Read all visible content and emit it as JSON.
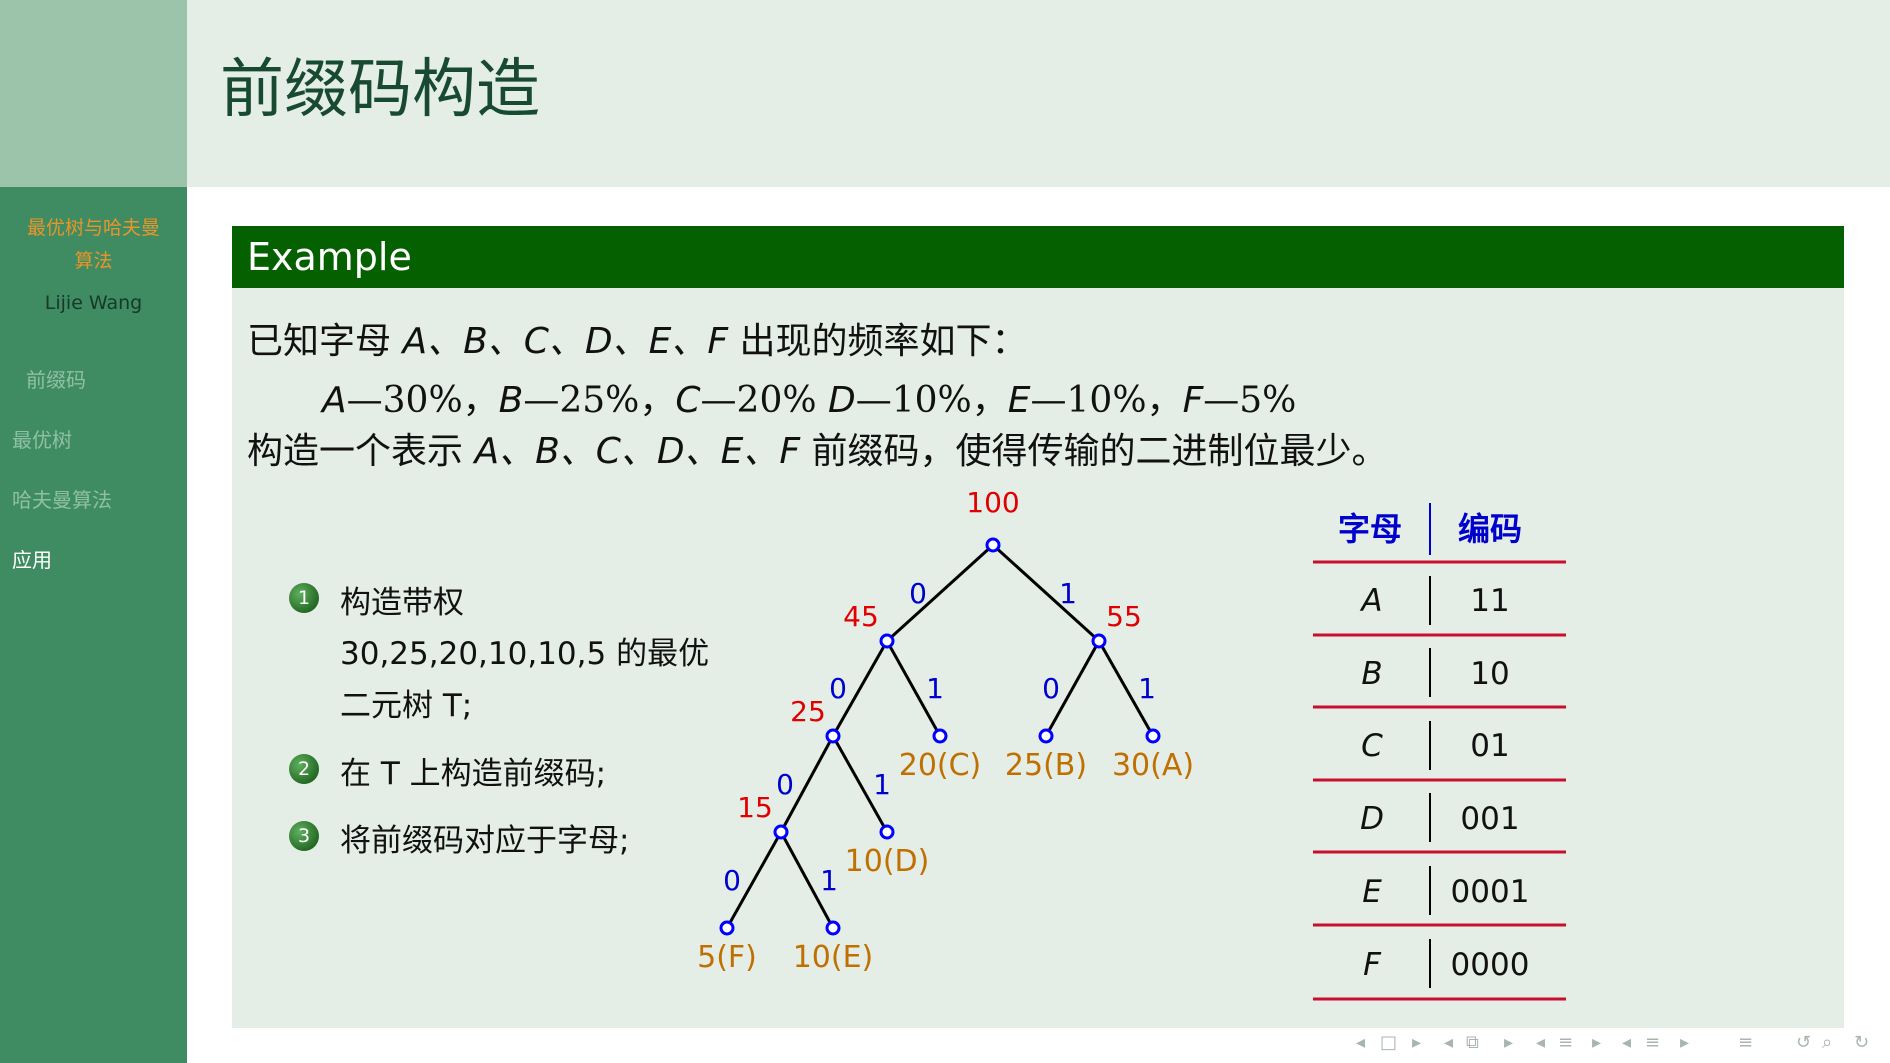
{
  "sidebar": {
    "title_lines": [
      "最优树与哈夫曼",
      "算法"
    ],
    "author": "Lijie Wang",
    "nav": [
      "前缀码",
      "最优树",
      "哈夫曼算法",
      "应用"
    ],
    "active": "应用"
  },
  "frame_title": "前缀码构造",
  "block": {
    "title": "Example",
    "line1": {
      "pre": "已知字母 ",
      "letters": "A、B、C、D、E、F",
      "post": " 出现的频率如下："
    },
    "freq": [
      {
        "letter": "A",
        "value": "—30%",
        "sep": "，"
      },
      {
        "letter": "B",
        "value": "—25%",
        "sep": "，"
      },
      {
        "letter": "C",
        "value": "—20%",
        "sep": " "
      },
      {
        "letter": "D",
        "value": "—10%",
        "sep": "，"
      },
      {
        "letter": "E",
        "value": "—10%",
        "sep": "，"
      },
      {
        "letter": "F",
        "value": "—5%",
        "sep": ""
      }
    ],
    "line3": {
      "pre": "构造一个表示 ",
      "letters": "A、B、C、D、E、F",
      "post": " 前缀码，使得传输的二进制位最少。"
    }
  },
  "steps": [
    {
      "num": "1",
      "lines": [
        "构造带权",
        "30,25,20,10,10,5 的最优",
        "二元树 T;"
      ]
    },
    {
      "num": "2",
      "lines": [
        "在 T 上构造前缀码;"
      ]
    },
    {
      "num": "3",
      "lines": [
        "将前缀码对应于字母;"
      ]
    }
  ],
  "tree": {
    "node_color": "#0000ff",
    "weight_color": "#e00000",
    "edge_label_color": "#0000cc",
    "leaf_color": "#c07000",
    "internal_weights": [
      "100",
      "45",
      "55",
      "25",
      "15"
    ],
    "edge_labels": [
      "0",
      "1",
      "0",
      "1",
      "0",
      "1",
      "0",
      "1",
      "0",
      "1"
    ],
    "leaves": [
      "20(C)",
      "25(B)",
      "30(A)",
      "10(D)",
      "5(F)",
      "10(E)"
    ]
  },
  "table": {
    "headers": [
      "字母",
      "编码"
    ],
    "header_color": "#0000cc",
    "rule_color": "#c8102e",
    "rows": [
      {
        "letter": "A",
        "code": "11"
      },
      {
        "letter": "B",
        "code": "10"
      },
      {
        "letter": "C",
        "code": "01"
      },
      {
        "letter": "D",
        "code": "001"
      },
      {
        "letter": "E",
        "code": "0001"
      },
      {
        "letter": "F",
        "code": "0000"
      }
    ]
  }
}
